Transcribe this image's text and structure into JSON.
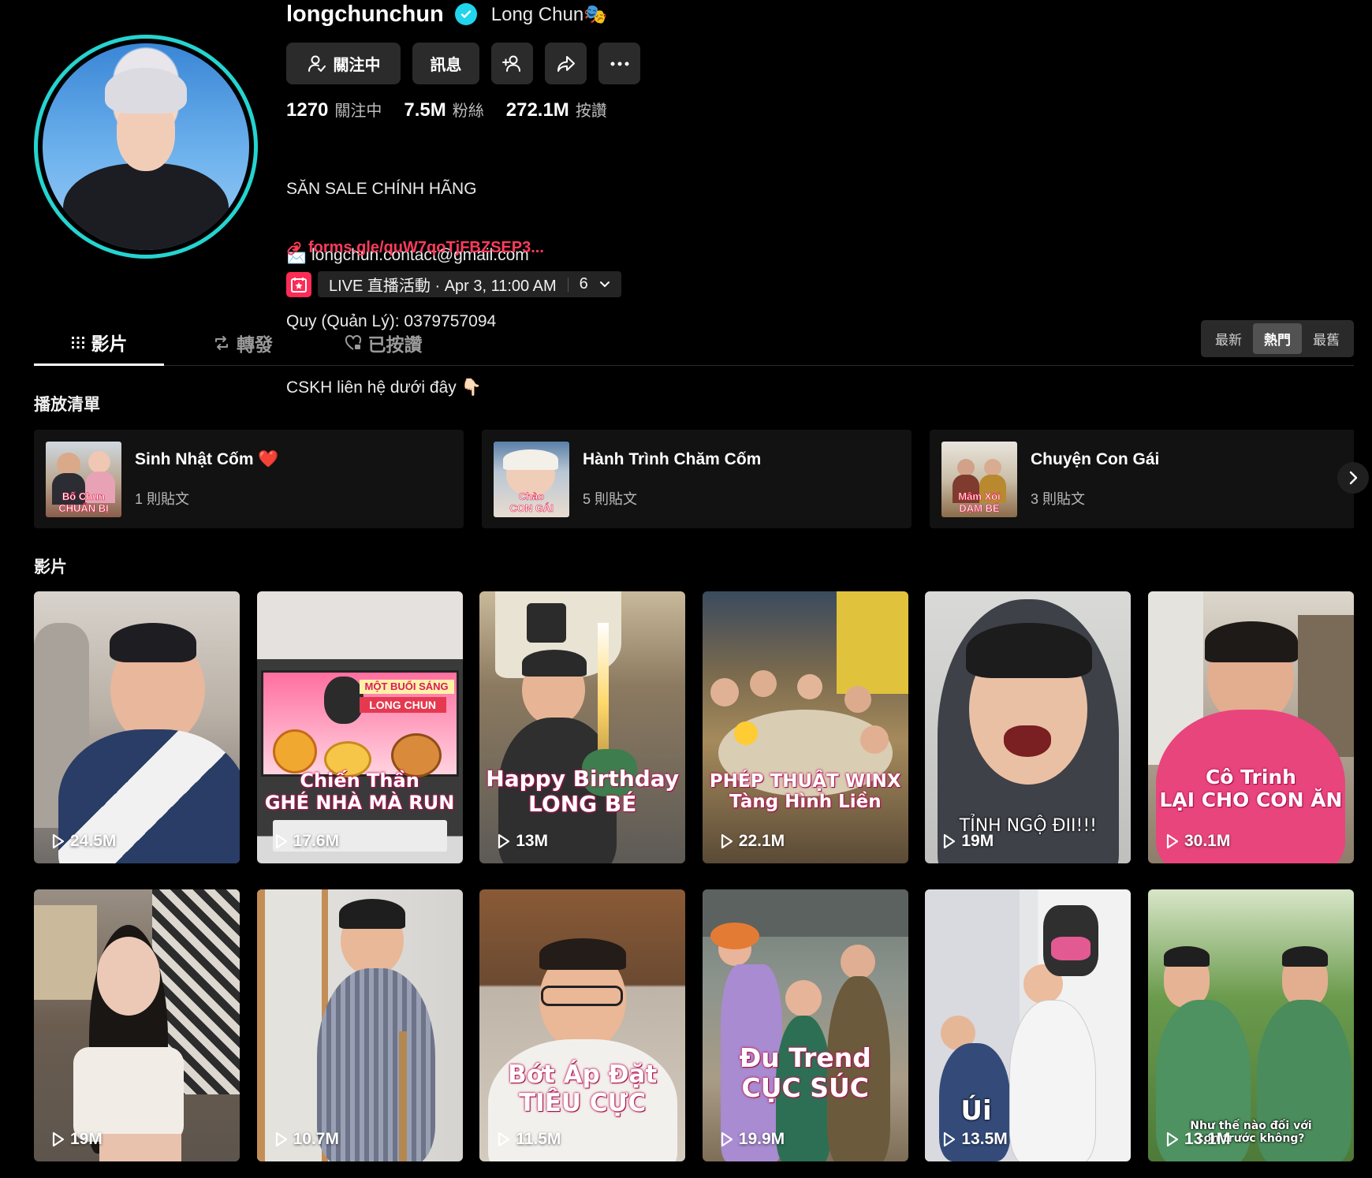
{
  "profile": {
    "username": "longchunchun",
    "nickname": "Long Chun🎭",
    "buttons": {
      "following": "關注中",
      "message": "訊息"
    },
    "stats": [
      {
        "value": "1270",
        "label": "關注中"
      },
      {
        "value": "7.5M",
        "label": "粉絲"
      },
      {
        "value": "272.1M",
        "label": "按讚"
      }
    ],
    "bio": [
      "SĂN SALE CHÍNH HÃNG",
      "📩 longchun.contact@gmail.com",
      "Quy (Quản Lý): 0379757094",
      "CSKH liên hệ dưới đây 👇🏻"
    ],
    "link": "forms.gle/quW7qoTjFBZSEP3...",
    "live": {
      "text": "LIVE 直播活動 · Apr 3, 11:00 AM",
      "count": "6"
    }
  },
  "tabs": {
    "videos": "影片",
    "reposts": "轉發",
    "liked": "已按讚"
  },
  "sort": {
    "latest": "最新",
    "popular": "熱門",
    "oldest": "最舊"
  },
  "playlists_title": "播放清單",
  "playlists": [
    {
      "title": "Sinh Nhật Cốm ❤️",
      "count": "1 則貼文",
      "thumb_text": "Bố Chun\nCHUẨN BỊ"
    },
    {
      "title": "Hành Trình Chăm Cốm",
      "count": "5 則貼文",
      "thumb_text": "Chào\nCON GÁI"
    },
    {
      "title": "Chuyện Con Gái",
      "count": "3 則貼文",
      "thumb_text": "Mâm Xôi\nDẠM BÉ"
    }
  ],
  "videos_title": "影片",
  "videos": [
    {
      "views": "24.5M",
      "caption": ""
    },
    {
      "views": "17.6M",
      "caption": "Chiến Thần\nGHÉ NHÀ MÀ RUN",
      "inner_top": "MỘT BUỔI SÁNG",
      "inner_bottom": "LONG CHUN"
    },
    {
      "views": "13M",
      "caption": "Happy Birthday\nLONG BÉ"
    },
    {
      "views": "22.1M",
      "caption": "PHÉP THUẬT WINX\nTàng Hình Liền"
    },
    {
      "views": "19M",
      "caption": "TỈNH NGỘ ĐII!!!"
    },
    {
      "views": "30.1M",
      "caption": "Cô Trinh\nLẠI CHO CON ĂN"
    },
    {
      "views": "19M",
      "caption": ""
    },
    {
      "views": "10.7M",
      "caption": ""
    },
    {
      "views": "11.5M",
      "caption": "Bớt Áp Đặt\nTIÊU CỰC"
    },
    {
      "views": "19.9M",
      "caption": "Đu Trend\nCỤC SÚC"
    },
    {
      "views": "13.5M",
      "caption": "Úi"
    },
    {
      "views": "13.1M",
      "caption": "Như thế nào đối với\ncon trước không?"
    }
  ],
  "colors": {
    "accent": "#fe2c55",
    "verified": "#20d5ec",
    "avatar_ring": "#25d4d0"
  }
}
